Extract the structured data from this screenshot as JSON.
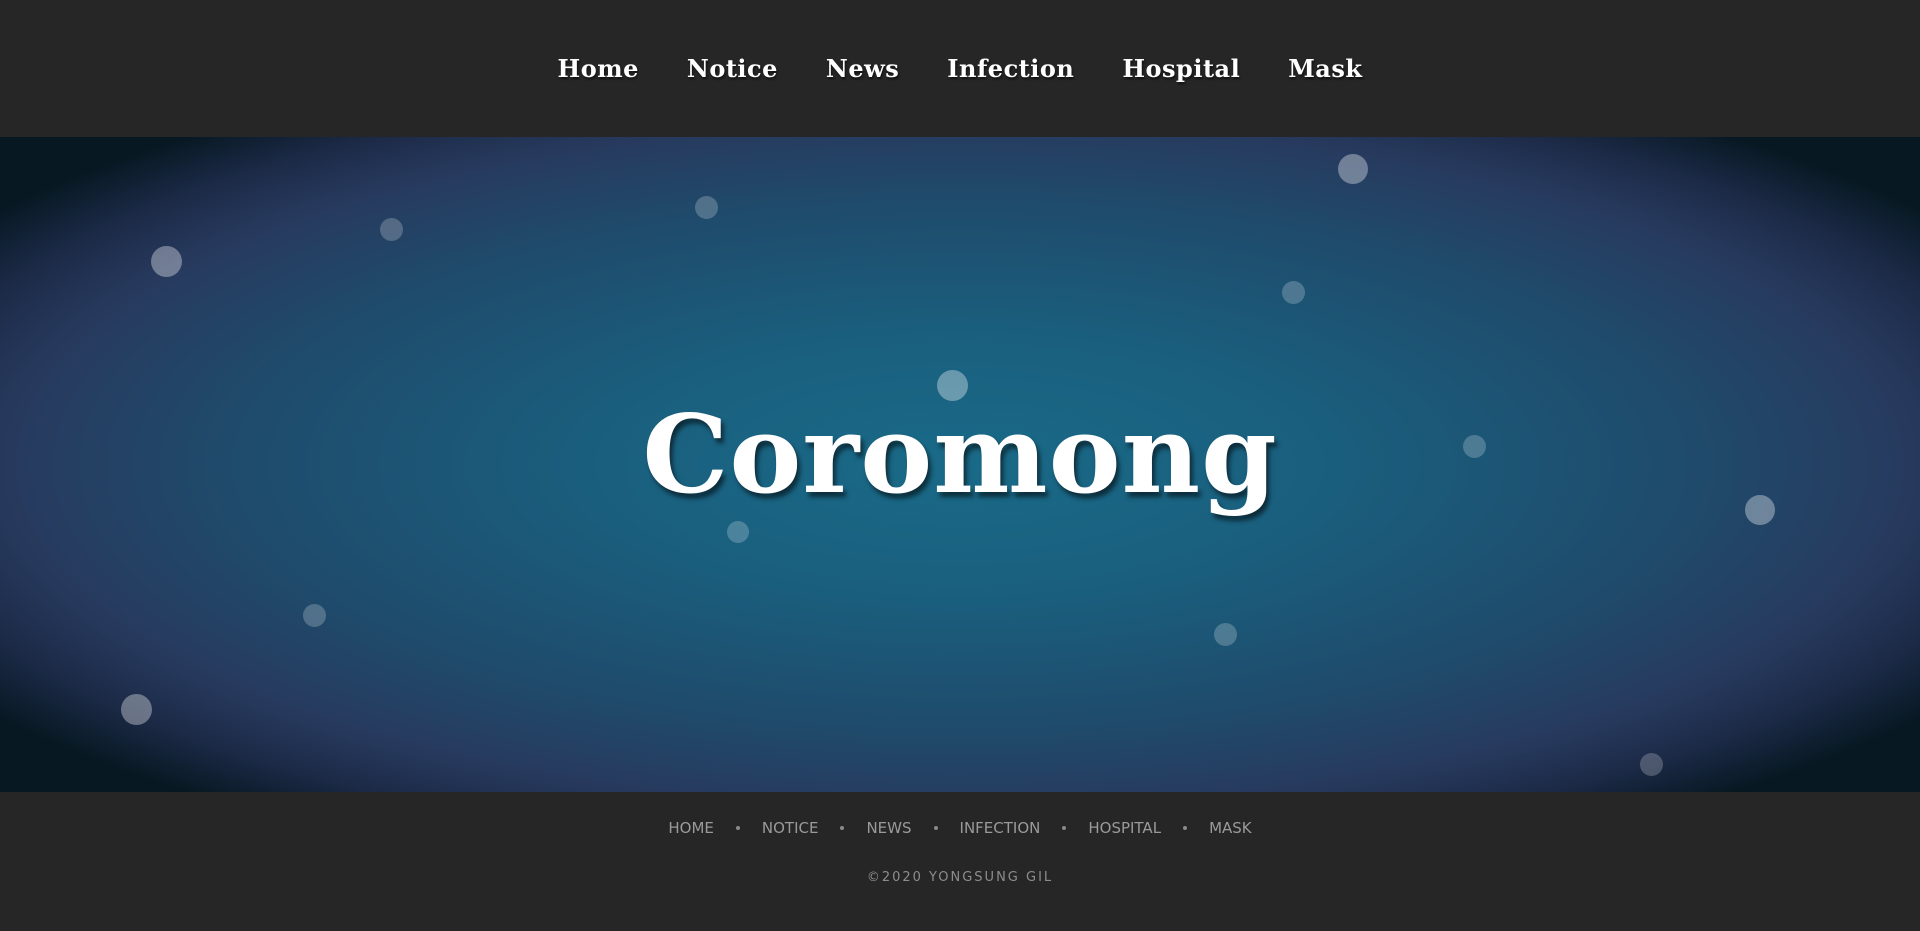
{
  "nav": {
    "items": [
      {
        "label": "Home"
      },
      {
        "label": "Notice"
      },
      {
        "label": "News"
      },
      {
        "label": "Infection"
      },
      {
        "label": "Hospital"
      },
      {
        "label": "Mask"
      }
    ]
  },
  "hero": {
    "title": "Coromong"
  },
  "footer": {
    "links": [
      {
        "label": "HOME"
      },
      {
        "label": "NOTICE"
      },
      {
        "label": "NEWS"
      },
      {
        "label": "INFECTION"
      },
      {
        "label": "HOSPITAL"
      },
      {
        "label": "MASK"
      }
    ],
    "copyright": "©2020 YONGSUNG GIL"
  },
  "colors": {
    "header_bg": "#262626",
    "hero_center": "#196a88",
    "hero_edge": "#273a5e",
    "footer_text": "#9a9a9a"
  }
}
